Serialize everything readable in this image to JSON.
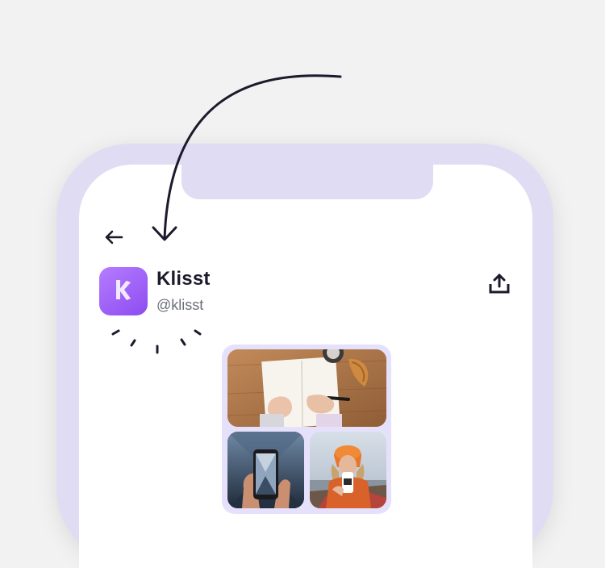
{
  "profile": {
    "name": "Klisst",
    "handle": "@klisst",
    "avatar_letter": "K"
  },
  "navigation": {
    "back_icon": "arrow-left-icon"
  },
  "actions": {
    "share_icon": "share-upload-icon"
  },
  "gallery": {
    "photos": [
      "notebook-writing-photo",
      "phone-camera-photo",
      "woman-orange-beanie-photo"
    ]
  },
  "colors": {
    "background": "#f2f2f2",
    "device_frame": "#e0dcf4",
    "screen": "#ffffff",
    "brand_purple": "#8d4cf0",
    "text_primary": "#1c1a2b",
    "text_secondary": "#6b6f78",
    "gallery_bg": "#e6e1fb"
  }
}
